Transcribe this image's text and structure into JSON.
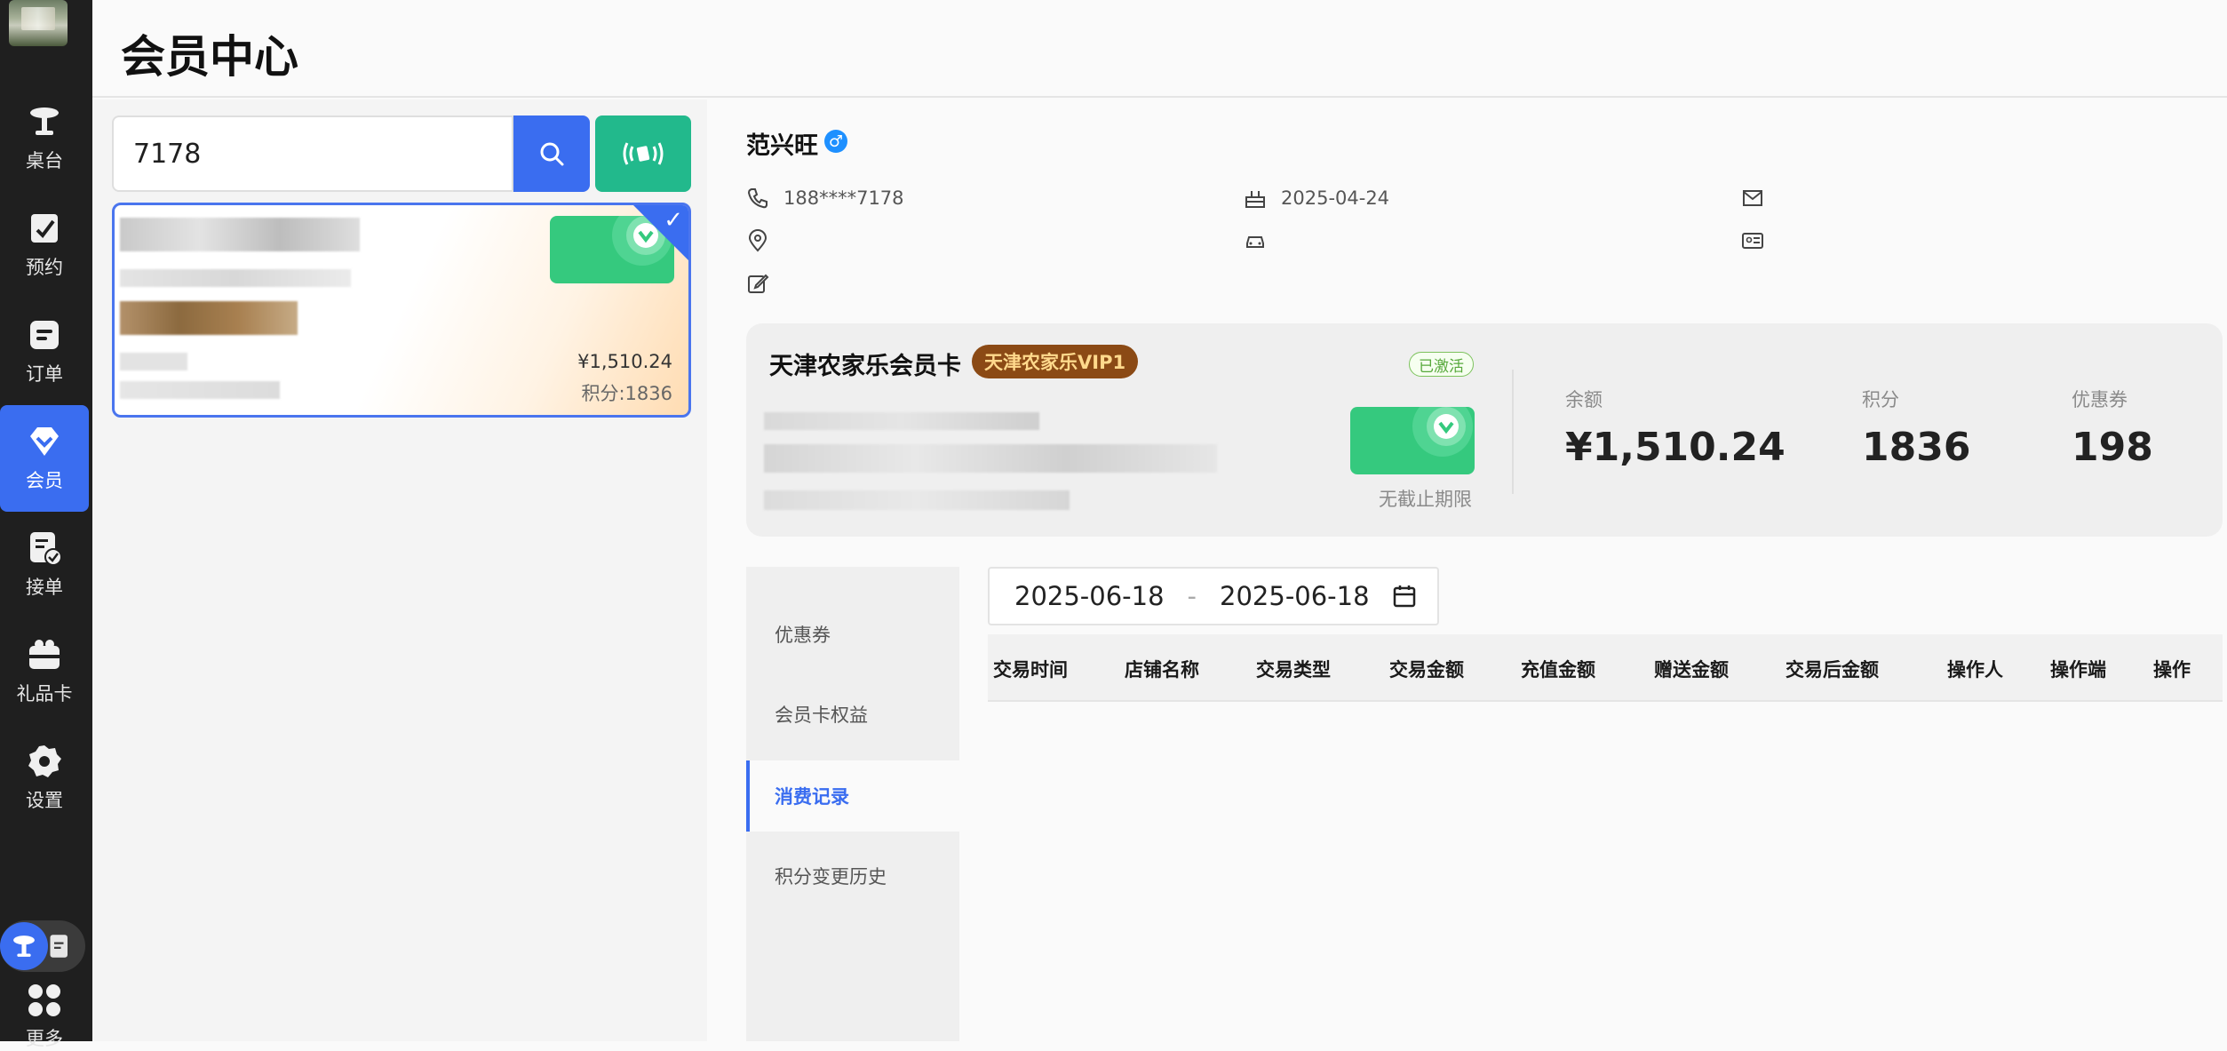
{
  "header": {
    "title": "会员中心"
  },
  "sidebar": {
    "items": [
      {
        "label": "桌台",
        "icon": "table-icon"
      },
      {
        "label": "预约",
        "icon": "reservation-icon"
      },
      {
        "label": "订单",
        "icon": "order-icon"
      },
      {
        "label": "会员",
        "icon": "member-icon",
        "active": true
      },
      {
        "label": "接单",
        "icon": "accept-order-icon"
      },
      {
        "label": "礼品卡",
        "icon": "gift-card-icon"
      },
      {
        "label": "设置",
        "icon": "settings-icon"
      }
    ],
    "more_label": "更多"
  },
  "search": {
    "value": "7178"
  },
  "member_card": {
    "balance": "¥1,510.24",
    "points": "积分:1836"
  },
  "profile": {
    "name": "范兴旺",
    "gender_symbol": "♂",
    "phone": "188****7178",
    "birthday": "2025-04-24"
  },
  "card": {
    "name": "天津农家乐会员卡",
    "level": "天津农家乐VIP1",
    "status": "已激活",
    "expire": "无截止期限",
    "stats": [
      {
        "label": "余额",
        "value": "¥1,510.24"
      },
      {
        "label": "积分",
        "value": "1836"
      },
      {
        "label": "优惠券",
        "value": "198"
      }
    ]
  },
  "tabs": [
    {
      "label": "优惠券"
    },
    {
      "label": "会员卡权益"
    },
    {
      "label": "消费记录",
      "active": true
    },
    {
      "label": "积分变更历史"
    }
  ],
  "date_range": {
    "start": "2025-06-18",
    "separator": "-",
    "end": "2025-06-18"
  },
  "table": {
    "columns": [
      "交易时间",
      "店铺名称",
      "交易类型",
      "交易金额",
      "充值金额",
      "赠送金额",
      "交易后金额",
      "操作人",
      "操作端",
      "操作"
    ],
    "rows": []
  },
  "colors": {
    "primary": "#3a6df0",
    "accent_green": "#22b98c",
    "sidebar_bg": "#1f1f1f",
    "badge_brown": "#8b4a15"
  }
}
